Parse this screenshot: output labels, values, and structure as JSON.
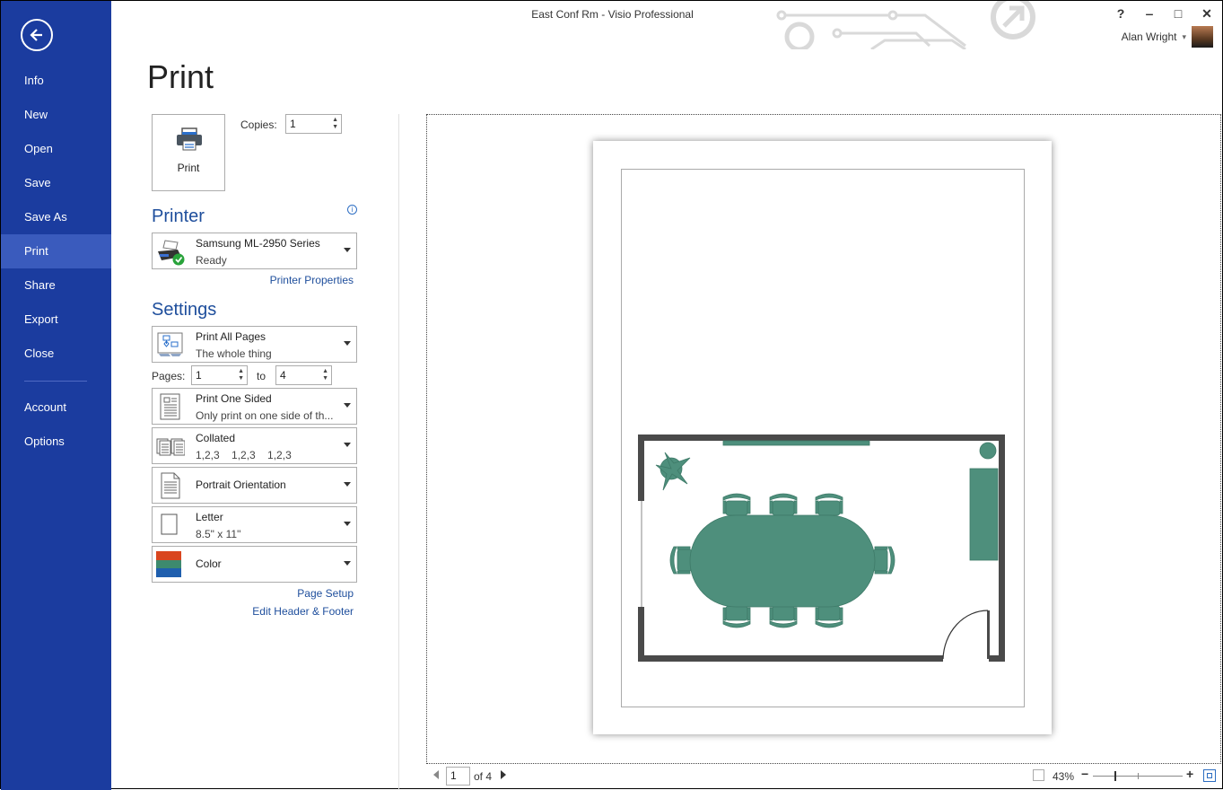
{
  "window": {
    "title": "East Conf Rm - Visio Professional",
    "help_label": "?",
    "minimize_label": "‒",
    "maximize_label": "□",
    "close_label": "✕",
    "user_name": "Alan Wright",
    "user_caret": "▾"
  },
  "sidebar": {
    "back_icon": "back-arrow-icon",
    "items": [
      {
        "label": "Info"
      },
      {
        "label": "New"
      },
      {
        "label": "Open"
      },
      {
        "label": "Save"
      },
      {
        "label": "Save As"
      },
      {
        "label": "Print",
        "active": true
      },
      {
        "label": "Share"
      },
      {
        "label": "Export"
      },
      {
        "label": "Close"
      },
      {
        "label": "Account"
      },
      {
        "label": "Options"
      }
    ]
  },
  "main": {
    "title": "Print",
    "print_button_label": "Print",
    "copies_label": "Copies:",
    "copies_value": "1",
    "printer": {
      "heading": "Printer",
      "name": "Samsung ML-2950 Series",
      "status": "Ready",
      "properties_link": "Printer Properties"
    },
    "settings": {
      "heading": "Settings",
      "print_range": {
        "title": "Print All Pages",
        "subtitle": "The whole thing"
      },
      "pages_label": "Pages:",
      "pages_from": "1",
      "to_label": "to",
      "pages_to": "4",
      "sides": {
        "title": "Print One Sided",
        "subtitle": "Only print on one side of th..."
      },
      "collation": {
        "title": "Collated",
        "subtitle": "1,2,3    1,2,3    1,2,3"
      },
      "orientation": {
        "title": "Portrait Orientation"
      },
      "paper": {
        "title": "Letter",
        "subtitle": "8.5\" x 11\""
      },
      "color": {
        "title": "Color",
        "swatch_colors": [
          "#d9461f",
          "#3d8a6e",
          "#1f5fae"
        ]
      },
      "page_setup_link": "Page Setup",
      "header_footer_link": "Edit Header & Footer"
    }
  },
  "preview": {
    "current_page": "1",
    "of_label": "of 4",
    "zoom_percent": "43%",
    "zoom_level": 0.43,
    "furniture_color": "#4e8f7c",
    "wall_color": "#4a4a4a"
  }
}
